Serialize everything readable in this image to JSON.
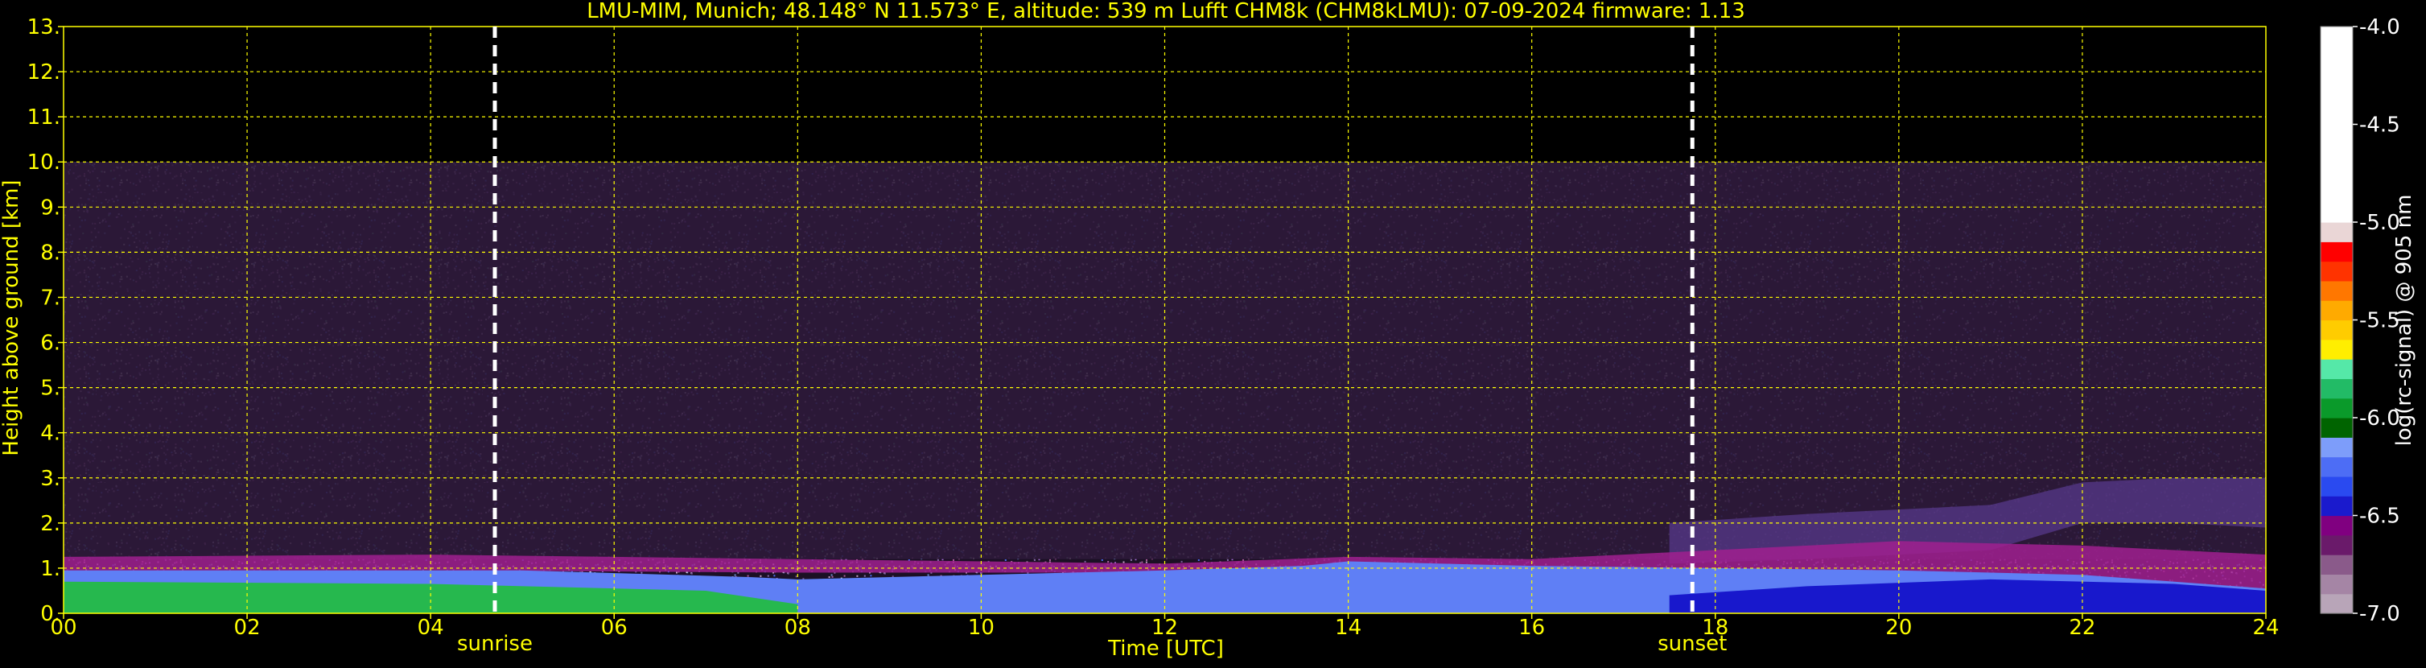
{
  "title": "LMU-MIM, Munich; 48.148° N 11.573° E, altitude: 539 m    Lufft CHM8k (CHM8kLMU): 07-09-2024    firmware: 1.13",
  "colors": {
    "background": "#000000",
    "axis_text": "#ffff00",
    "grid": "#ffff00",
    "marker": "#ffffff",
    "colorbar_label": "#ffffff"
  },
  "chart_data": {
    "type": "heatmap",
    "title": "LMU-MIM, Munich; 48.148° N 11.573° E, altitude: 539 m    Lufft CHM8k (CHM8kLMU): 07-09-2024    firmware: 1.13",
    "xlabel": "Time [UTC]",
    "ylabel": "Height above ground [km]",
    "xlim": [
      0,
      24
    ],
    "ylim": [
      0,
      13
    ],
    "x_ticks": [
      0,
      2,
      4,
      6,
      8,
      10,
      12,
      14,
      16,
      18,
      20,
      22,
      24
    ],
    "x_tick_labels": [
      "00",
      "02",
      "04",
      "06",
      "08",
      "10",
      "12",
      "14",
      "16",
      "18",
      "20",
      "22",
      "24"
    ],
    "y_ticks": [
      0,
      1,
      2,
      3,
      4,
      5,
      6,
      7,
      8,
      9,
      10,
      11,
      12,
      13
    ],
    "y_tick_labels": [
      "0.",
      "1.",
      "2.",
      "3.",
      "4.",
      "5.",
      "6.",
      "7.",
      "8.",
      "9.",
      "10.",
      "11.",
      "12.",
      "13."
    ],
    "grid": true,
    "data_top_km": 10,
    "markers": [
      {
        "label": "sunrise",
        "time": 4.7
      },
      {
        "label": "sunset",
        "time": 17.75
      }
    ],
    "colorbar": {
      "label": "log(rc-signal) @ 905 nm",
      "range": [
        -7.0,
        -4.0
      ],
      "ticks": [
        -4.0,
        -4.5,
        -5.0,
        -5.5,
        -6.0,
        -6.5,
        -7.0
      ],
      "tick_labels": [
        "-4.0",
        "-4.5",
        "-5.0",
        "-5.5",
        "-6.0",
        "-6.5",
        "-7.0"
      ],
      "segments": [
        {
          "from": -7.0,
          "to": -6.9,
          "color": "#b8a5b8"
        },
        {
          "from": -6.9,
          "to": -6.8,
          "color": "#a585a5"
        },
        {
          "from": -6.8,
          "to": -6.7,
          "color": "#8a5a8a"
        },
        {
          "from": -6.7,
          "to": -6.6,
          "color": "#6a1a6a"
        },
        {
          "from": -6.6,
          "to": -6.5,
          "color": "#800080"
        },
        {
          "from": -6.5,
          "to": -6.4,
          "color": "#1a1acd"
        },
        {
          "from": -6.4,
          "to": -6.3,
          "color": "#2a4af0"
        },
        {
          "from": -6.3,
          "to": -6.2,
          "color": "#4d6df5"
        },
        {
          "from": -6.2,
          "to": -6.1,
          "color": "#7d9dfa"
        },
        {
          "from": -6.1,
          "to": -6.0,
          "color": "#006400"
        },
        {
          "from": -6.0,
          "to": -5.9,
          "color": "#0a9a2a"
        },
        {
          "from": -5.9,
          "to": -5.8,
          "color": "#22bb66"
        },
        {
          "from": -5.8,
          "to": -5.7,
          "color": "#55e8a8"
        },
        {
          "from": -5.7,
          "to": -5.6,
          "color": "#ffee00"
        },
        {
          "from": -5.6,
          "to": -5.5,
          "color": "#ffcc00"
        },
        {
          "from": -5.5,
          "to": -5.4,
          "color": "#ffaa00"
        },
        {
          "from": -5.4,
          "to": -5.3,
          "color": "#ff7700"
        },
        {
          "from": -5.3,
          "to": -5.2,
          "color": "#ff3300"
        },
        {
          "from": -5.2,
          "to": -5.1,
          "color": "#ff0000"
        },
        {
          "from": -5.1,
          "to": -5.0,
          "color": "#ead6d6"
        },
        {
          "from": -5.0,
          "to": -4.0,
          "color": "#ffffff"
        }
      ]
    },
    "layers": [
      {
        "name": "noise",
        "times": [
          0,
          24
        ],
        "bottoms": [
          1.2,
          1.2
        ],
        "tops": [
          10,
          10
        ],
        "color": "#2e1a3a",
        "opacity": 0.9
      },
      {
        "name": "upper-aerosol",
        "times": [
          17.5,
          19,
          21,
          22,
          23,
          24
        ],
        "bottoms": [
          1.1,
          1.2,
          1.4,
          2.0,
          2.0,
          1.9
        ],
        "tops": [
          2.0,
          2.2,
          2.4,
          2.9,
          3.0,
          3.0
        ],
        "color": "#5a3a90",
        "opacity": 0.7
      },
      {
        "name": "residual-layer",
        "times": [
          0,
          4,
          8,
          12,
          14,
          16,
          18,
          20,
          22,
          24
        ],
        "bottoms": [
          0.9,
          0.95,
          0.9,
          0.9,
          1.0,
          1.0,
          0.9,
          0.9,
          0.8,
          0.5
        ],
        "tops": [
          1.25,
          1.3,
          1.2,
          1.1,
          1.25,
          1.2,
          1.4,
          1.6,
          1.5,
          1.3
        ],
        "color": "#a0208f",
        "opacity": 0.85
      },
      {
        "name": "boundary-layer",
        "times": [
          0,
          5,
          7.5,
          8,
          10,
          12,
          13.5,
          14,
          16,
          18,
          20,
          22,
          24
        ],
        "bottoms": [
          0,
          0,
          0,
          0,
          0,
          0,
          0,
          0,
          0,
          0,
          0,
          0,
          0
        ],
        "tops": [
          0.95,
          0.95,
          0.8,
          0.75,
          0.85,
          0.95,
          1.05,
          1.15,
          1.05,
          1.0,
          0.95,
          0.85,
          0.55
        ],
        "color": "#5f7ff5",
        "opacity": 1.0
      },
      {
        "name": "night-dense",
        "times": [
          0,
          4,
          7,
          8
        ],
        "bottoms": [
          0,
          0,
          0,
          0
        ],
        "tops": [
          0.7,
          0.65,
          0.5,
          0.2
        ],
        "color": "#26b84e",
        "opacity": 1.0
      },
      {
        "name": "evening-dense",
        "times": [
          17.5,
          19,
          21,
          23,
          24
        ],
        "bottoms": [
          0,
          0,
          0,
          0,
          0
        ],
        "tops": [
          0.4,
          0.6,
          0.75,
          0.65,
          0.5
        ],
        "color": "#1818cc",
        "opacity": 1.0
      }
    ]
  }
}
